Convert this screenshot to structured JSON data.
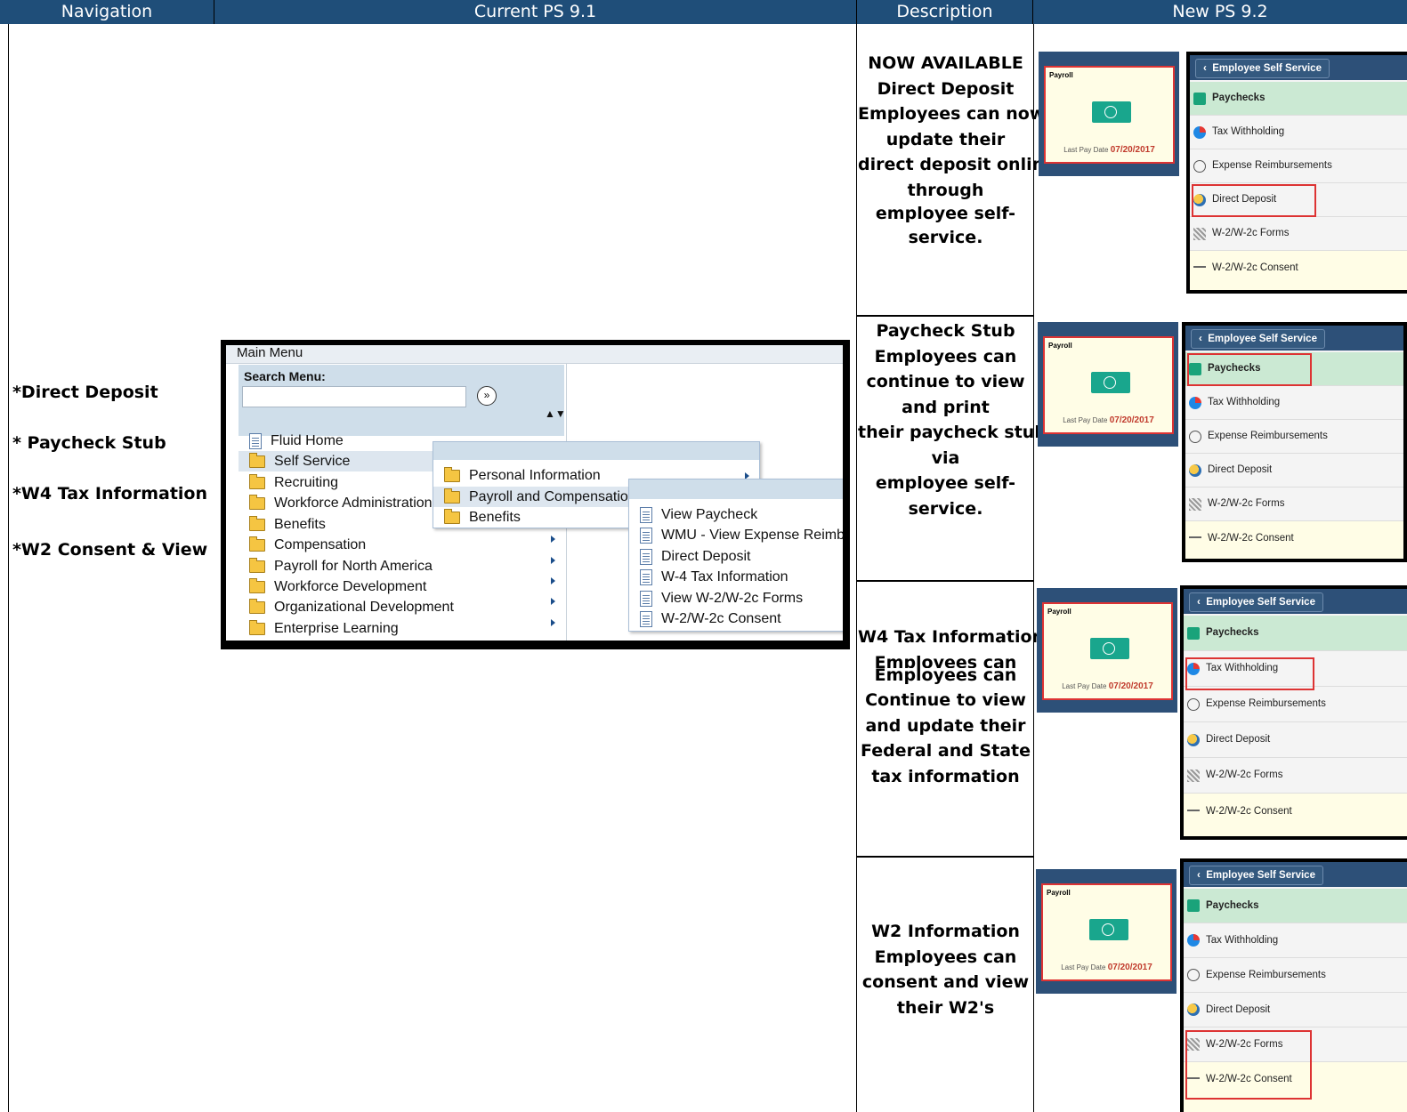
{
  "headers": [
    "Navigation",
    "Current PS 9.1",
    "Description",
    "New PS 9.2"
  ],
  "navigation": [
    "*Direct Deposit",
    "* Paycheck Stub",
    "*W4 Tax Information",
    "*W2 Consent & View"
  ],
  "old_menu": {
    "title": "Main Menu",
    "search_label": "Search Menu:",
    "main_items": [
      "Fluid Home",
      "Self Service",
      "Recruiting",
      "Workforce Administration",
      "Benefits",
      "Compensation",
      "Payroll for North America",
      "Workforce Development",
      "Organizational Development",
      "Enterprise Learning"
    ],
    "self_service_items": [
      "Personal Information",
      "Payroll and Compensation",
      "Benefits"
    ],
    "payroll_items": [
      "View Paycheck",
      "WMU - View Expense Reimb.",
      "Direct Deposit",
      "W-4 Tax Information",
      "View W-2/W-2c Forms",
      "W-2/W-2c Consent"
    ]
  },
  "descriptions": [
    [
      "NOW AVAILABLE",
      "Direct Deposit",
      "Employees can now",
      "update their",
      "direct deposit online",
      "through",
      "employee self-",
      "service."
    ],
    [
      "Paycheck Stub",
      "Employees can",
      "continue to view",
      "and print",
      "their paycheck stubs",
      "via",
      "employee self-",
      "service."
    ],
    [
      "W4 Tax Information",
      "Emplovees can",
      "Employees can",
      "Continue to view",
      "and update their",
      "Federal and State",
      "tax information"
    ],
    [
      "W2 Information",
      "Employees can",
      "consent and view",
      "their W2's"
    ]
  ],
  "tile": {
    "title": "Payroll",
    "date_label": "Last Pay Date",
    "date": "07/20/2017"
  },
  "ess": {
    "title": "Employee Self Service",
    "items": [
      "Paycheckss",
      "Tax Withholding",
      "Expense Reimbursements",
      "Direct Deposit",
      "W-2/W-2c Forms",
      "W-2/W-2c Consent"
    ]
  },
  "colors": {
    "header_bg": "#1f4e79",
    "highlight": "#dd3333",
    "paychecks_bg": "#cbe9d3"
  }
}
